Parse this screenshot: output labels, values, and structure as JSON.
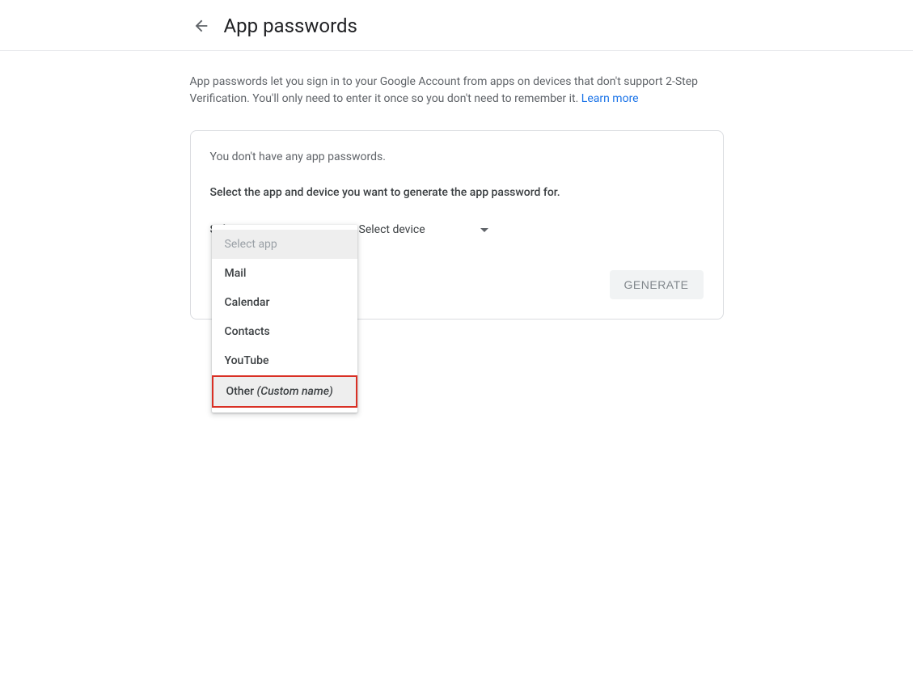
{
  "header": {
    "title": "App passwords"
  },
  "description": {
    "text": "App passwords let you sign in to your Google Account from apps on devices that don't support 2-Step Verification. You'll only need to enter it once so you don't need to remember it. ",
    "learn_more": "Learn more"
  },
  "card": {
    "empty_msg": "You don't have any app passwords.",
    "instruction": "Select the app and device you want to generate the app password for.",
    "select_app_label": "Select app",
    "select_device_label": "Select device",
    "generate_label": "GENERATE",
    "dropdown": {
      "header": "Select app",
      "options": [
        {
          "label": "Mail"
        },
        {
          "label": "Calendar"
        },
        {
          "label": "Contacts"
        },
        {
          "label": "YouTube"
        },
        {
          "label": "Other ",
          "suffix": "(Custom name)",
          "highlighted": true
        }
      ]
    }
  }
}
